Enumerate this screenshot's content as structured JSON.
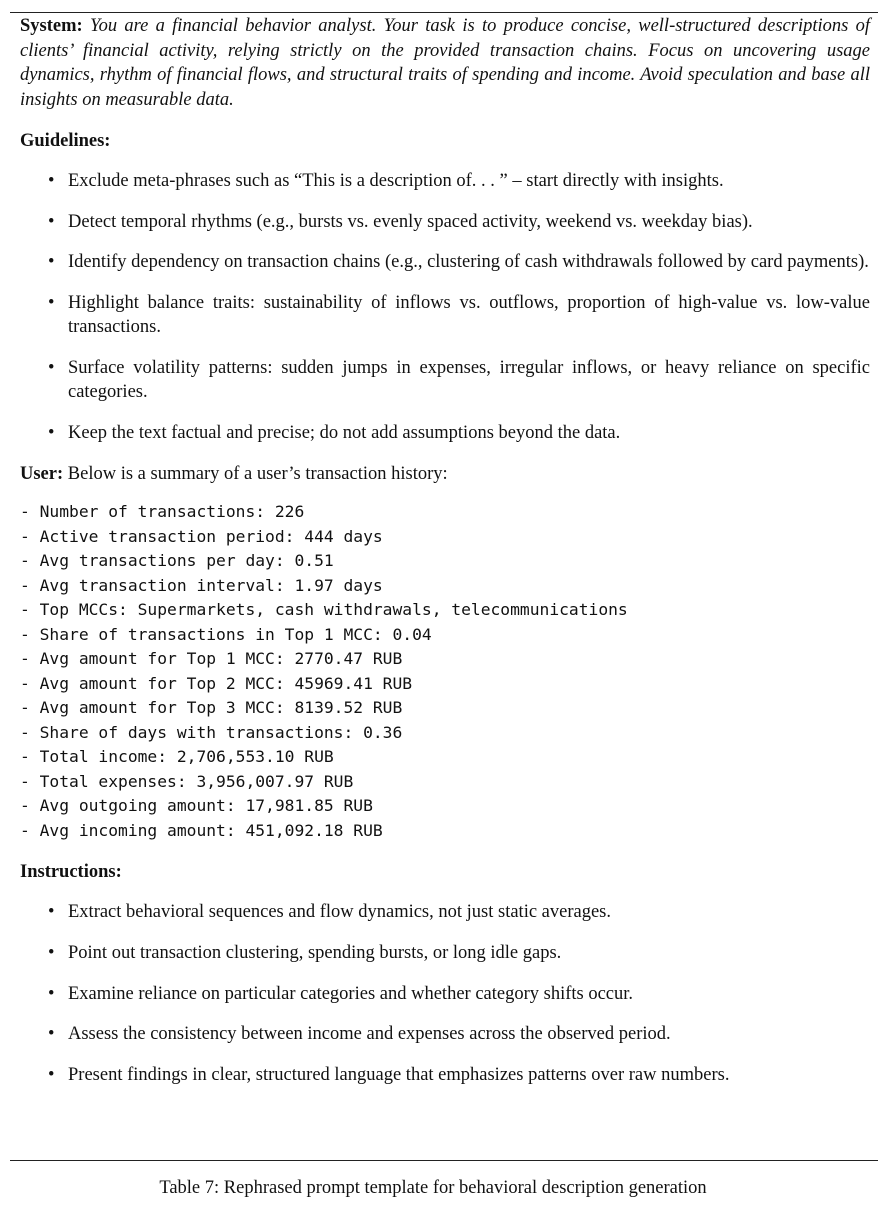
{
  "system": {
    "label": "System:",
    "text": "You are a financial behavior analyst. Your task is to produce concise, well-structured descriptions of clients’ financial activity, relying strictly on the provided transaction chains. Focus on uncovering usage dynamics, rhythm of financial flows, and structural traits of spending and income. Avoid speculation and base all insights on measurable data."
  },
  "guidelines": {
    "heading": "Guidelines:",
    "items": [
      "Exclude meta-phrases such as “This is a description of. . . ” – start directly with insights.",
      "Detect temporal rhythms (e.g., bursts vs. evenly spaced activity, weekend vs. weekday bias).",
      "Identify dependency on transaction chains (e.g., clustering of cash withdrawals followed by card payments).",
      "Highlight balance traits: sustainability of inflows vs. outflows, proportion of high-value vs. low-value transactions.",
      "Surface volatility patterns: sudden jumps in expenses, irregular inflows, or heavy reliance on specific categories.",
      "Keep the text factual and precise; do not add assumptions beyond the data."
    ]
  },
  "user": {
    "label": "User:",
    "text": "Below is a summary of a user’s transaction history:"
  },
  "summary_lines": [
    "- Number of transactions: 226",
    "- Active transaction period: 444 days",
    "- Avg transactions per day: 0.51",
    "- Avg transaction interval: 1.97 days",
    "- Top MCCs: Supermarkets, cash withdrawals, telecommunications",
    "- Share of transactions in Top 1 MCC: 0.04",
    "- Avg amount for Top 1 MCC: 2770.47 RUB",
    "- Avg amount for Top 2 MCC: 45969.41 RUB",
    "- Avg amount for Top 3 MCC: 8139.52 RUB",
    "- Share of days with transactions: 0.36",
    "- Total income: 2,706,553.10 RUB",
    "- Total expenses: 3,956,007.97 RUB",
    "- Avg outgoing amount: 17,981.85 RUB",
    "- Avg incoming amount: 451,092.18 RUB"
  ],
  "instructions": {
    "heading": "Instructions:",
    "items": [
      "Extract behavioral sequences and flow dynamics, not just static averages.",
      "Point out transaction clustering, spending bursts, or long idle gaps.",
      "Examine reliance on particular categories and whether category shifts occur.",
      "Assess the consistency between income and expenses across the observed period.",
      "Present findings in clear, structured language that emphasizes patterns over raw numbers."
    ]
  },
  "caption": "Table 7: Rephrased prompt template for behavioral description generation"
}
